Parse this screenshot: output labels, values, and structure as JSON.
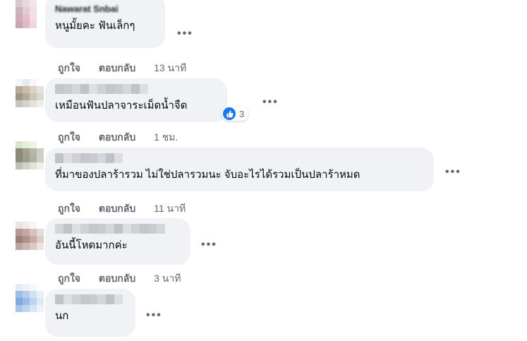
{
  "comments": [
    {
      "author": "Nawarat Snbai",
      "text": "หนูมั้ยคะ ฟันเล็กๆ",
      "like_label": "ถูกใจ",
      "reply_label": "ตอบกลับ",
      "time": "13 นาที",
      "avatar_colors": [
        "#d9c8cf",
        "#e8d9df",
        "#f2e6ec",
        "#ffffff",
        "#cdb3bc",
        "#e2cbd3",
        "#f0dfe6",
        "#ffffff",
        "#d8a9ba",
        "#e6bccb",
        "#f5dbe4",
        "#ffffff",
        "#caa6b3",
        "#ddbac6",
        "#efd5de",
        "#ffffff"
      ]
    },
    {
      "author": "",
      "text": "เหมือนฟันปลาจาระเม็ดน้ำจืด",
      "like_label": "ถูกใจ",
      "reply_label": "ตอบกลับ",
      "time": "1 ชม.",
      "reaction_count": "3",
      "avatar_colors": [
        "#f2f4f7",
        "#e6eaee",
        "#f4f6f8",
        "#ffffff",
        "#b7ab9a",
        "#c8bda9",
        "#d9d2c5",
        "#e4e2dc",
        "#9e9488",
        "#b5ab9d",
        "#cdc6ba",
        "#dcd9d2",
        "#c7c3bd",
        "#d6d2cc",
        "#e4e1dc",
        "#eeeeee"
      ]
    },
    {
      "author": "",
      "text": "ที่มาของปลาร้ารวม ไม่ใช่ปลารวมนะ จับอะไรได้รวมเป็นปลาร้าหมด",
      "like_label": "ถูกใจ",
      "reply_label": "ตอบกลับ",
      "time": "11 นาที",
      "avatar_colors": [
        "#d7e5c8",
        "#e5eddb",
        "#eef3e8",
        "#ffffff",
        "#8b8a74",
        "#a3a28c",
        "#b8b6a4",
        "#d0cec2",
        "#8a8d7c",
        "#9c9e8f",
        "#b2b2a3",
        "#cfcfc5",
        "#c2c1b8",
        "#d3d2ca",
        "#e2e1db",
        "#efefeb"
      ]
    },
    {
      "author": "",
      "text": "อันนี้โหดมากค่ะ",
      "like_label": "ถูกใจ",
      "reply_label": "ตอบกลับ",
      "time": "3 นาที",
      "avatar_colors": [
        "#e9e3e1",
        "#f1ecea",
        "#f7f4f3",
        "#ffffff",
        "#b49a92",
        "#c4aaa2",
        "#d7c3bd",
        "#e8dcd8",
        "#9b7f78",
        "#ae938b",
        "#c5ada6",
        "#dccbc6",
        "#bba7a1",
        "#cbb8b2",
        "#dacac5",
        "#ece2df"
      ]
    },
    {
      "author": "",
      "text": "นก",
      "like_label": "ถูกใจ",
      "reply_label": "ตอบกลับ",
      "time": "",
      "avatar_colors": [
        "#e4edf7",
        "#eef3fa",
        "#f6f9fc",
        "#ffffff",
        "#9dbfe6",
        "#b6cfee",
        "#d2e2f5",
        "#e9f0fa",
        "#7ea9dd",
        "#9bbce4",
        "#bfd5ef",
        "#dfeaf7",
        "#a9c5e9",
        "#c0d5ef",
        "#d8e5f5",
        "#edf3fa"
      ]
    }
  ],
  "colors": {
    "bubble": "#f0f2f5",
    "meta_text": "#65676b",
    "like_blue": "#1877f2"
  },
  "icons": {
    "more": "more-options-icon",
    "like": "like-thumb-icon"
  }
}
